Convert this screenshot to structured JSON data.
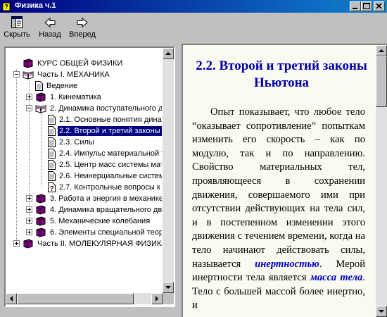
{
  "window": {
    "title": "Физика ч.1"
  },
  "toolbar": {
    "hide_label": "Скрыть",
    "back_label": "Назад",
    "forward_label": "Вперед"
  },
  "tree": {
    "items": [
      {
        "label": "КУРС ОБЩЕЙ ФИЗИКИ",
        "icon": "closed-book-icon"
      },
      {
        "label": "Часть I. МЕХАНИКА",
        "icon": "open-book-icon"
      },
      {
        "label": "Ведение",
        "icon": "page-icon"
      },
      {
        "label": "1. Кинематика",
        "icon": "closed-book-icon"
      },
      {
        "label": "2. Динамика поступательного дв",
        "icon": "open-book-icon"
      },
      {
        "label": "2.1. Основные понятия динам",
        "icon": "page-icon"
      },
      {
        "label": "2.2. Второй и третий законы Н",
        "icon": "page-icon",
        "selected": true
      },
      {
        "label": "2.3. Силы",
        "icon": "page-icon"
      },
      {
        "label": "2.4. Импульс материальной т",
        "icon": "page-icon"
      },
      {
        "label": "2.5. Центр масс системы мат",
        "icon": "page-icon"
      },
      {
        "label": "2.6. Неинерциальные систем",
        "icon": "page-icon"
      },
      {
        "label": "2.7. Контрольные вопросы к н",
        "icon": "question-page-icon"
      },
      {
        "label": "3. Работа и энергия в механике п",
        "icon": "closed-book-icon"
      },
      {
        "label": "4. Динамика вращательного дви",
        "icon": "closed-book-icon"
      },
      {
        "label": "5. Механические колебания",
        "icon": "closed-book-icon"
      },
      {
        "label": "6. Элементы специальной теори",
        "icon": "closed-book-icon"
      },
      {
        "label": "Часть II. МОЛЕКУЛЯРНАЯ ФИЗИКА",
        "icon": "closed-book-icon"
      }
    ]
  },
  "content": {
    "heading": "2.2. Второй и третий законы Ньютона",
    "p_before_1": "Опыт показывает, что любое тело “оказывает сопротивление” попыткам изменить его скорость – как по модулю, так и по направлению. Свойство материальных тел, проявляющееся в сохранении движения, совершаемого ими при отсутствии действующих на тела сил, и в постепенном изменении этого движения с течением времени, когда на тело начинают действовать силы, называется ",
    "term_1": "инертностью",
    "p_between": ". Мерой инертности тела является ",
    "term_2": "масса тела",
    "p_after_2": ". Тело с большей массой более инертно, и"
  },
  "colors": {
    "title_bar": "#000080",
    "heading": "#0000a8",
    "term": "#0000c0",
    "selection": "#000080",
    "content_bg": "#fafaf0"
  }
}
